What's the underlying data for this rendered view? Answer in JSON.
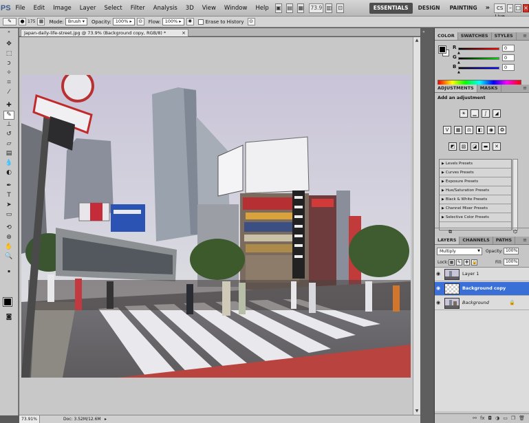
{
  "app": {
    "logo": "PS"
  },
  "menu": [
    "File",
    "Edit",
    "Image",
    "Layer",
    "Select",
    "Filter",
    "Analysis",
    "3D",
    "View",
    "Window",
    "Help"
  ],
  "menubar": {
    "zoom": "73.9",
    "workspaces": [
      "ESSENTIALS",
      "DESIGN",
      "PAINTING"
    ],
    "more": "»",
    "cs_live": "CS Live",
    "window_buttons": [
      "–",
      "□",
      "×"
    ]
  },
  "options": {
    "brush_size": "175",
    "mode_label": "Mode:",
    "mode_value": "Brush",
    "opacity_label": "Opacity:",
    "opacity_value": "100%",
    "flow_label": "Flow:",
    "flow_value": "100%",
    "erase_history": "Erase to History"
  },
  "document": {
    "tab_title": "Japan-daily-life-street.jpg @ 73.9% (Background copy, RGB/8) *",
    "tab_close": "×",
    "status_zoom": "73.91%",
    "status_doc": "Doc: 3.52M/12.6M"
  },
  "color_panel": {
    "tabs": [
      "COLOR",
      "SWATCHES",
      "STYLES"
    ],
    "channels": [
      {
        "label": "R",
        "value": "0"
      },
      {
        "label": "G",
        "value": "0"
      },
      {
        "label": "B",
        "value": "0"
      }
    ]
  },
  "adjustments_panel": {
    "tabs": [
      "ADJUSTMENTS",
      "MASKS"
    ],
    "title": "Add an adjustment",
    "presets": [
      "Levels Presets",
      "Curves Presets",
      "Exposure Presets",
      "Hue/Saturation Presets",
      "Black & White Presets",
      "Channel Mixer Presets",
      "Selective Color Presets"
    ]
  },
  "layers_panel": {
    "tabs": [
      "LAYERS",
      "CHANNELS",
      "PATHS"
    ],
    "blend_mode": "Multiply",
    "opacity_label": "Opacity:",
    "opacity_value": "100%",
    "lock_label": "Lock:",
    "fill_label": "Fill:",
    "fill_value": "100%",
    "layers": [
      {
        "name": "Layer 1",
        "selected": false
      },
      {
        "name": "Background copy",
        "selected": true
      },
      {
        "name": "Background",
        "selected": false,
        "locked": true
      }
    ]
  },
  "colors": {
    "accent_selection": "#3a6fd8",
    "workspace_active": "#4e4e4e",
    "close_red": "#c8352a"
  }
}
